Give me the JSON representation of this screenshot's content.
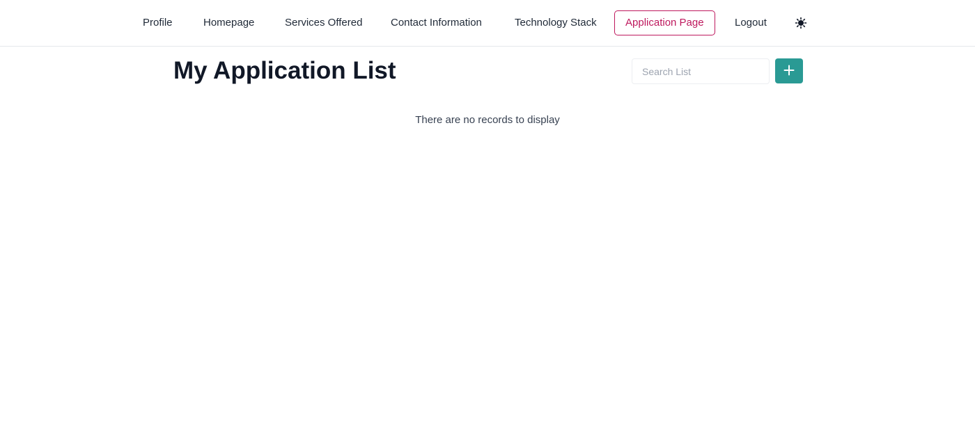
{
  "nav": {
    "items": [
      {
        "label": "Profile"
      },
      {
        "label": "Homepage"
      },
      {
        "label": "Services Offered"
      },
      {
        "label": "Contact Information"
      },
      {
        "label": "Technology Stack"
      },
      {
        "label": "Application Page",
        "active": true
      },
      {
        "label": "Logout"
      }
    ],
    "theme_icon": "sun-icon",
    "accent_color": "#be185d"
  },
  "main": {
    "title": "My Application List",
    "search": {
      "placeholder": "Search List",
      "value": ""
    },
    "add_button": {
      "icon": "plus-icon",
      "color": "#2a9a94"
    },
    "empty_message": "There are no records to display"
  }
}
